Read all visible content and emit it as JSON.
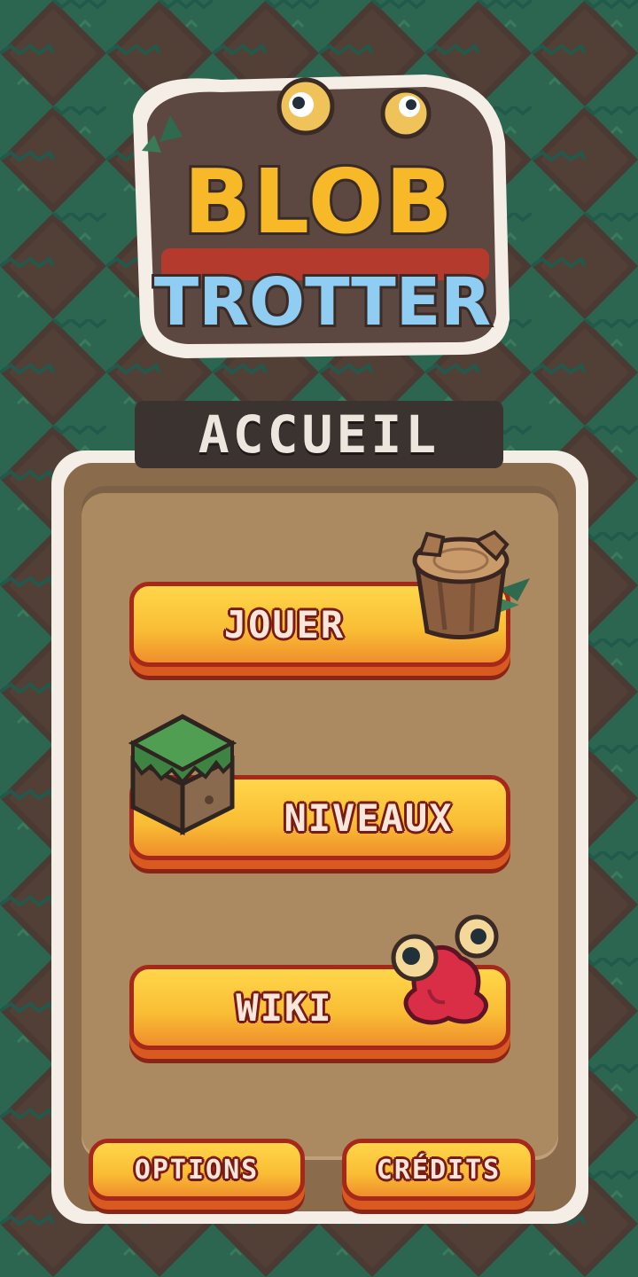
{
  "logo": {
    "line1": "BLOB",
    "line2": "TROTTER"
  },
  "screen": {
    "title": "ACCUEIL"
  },
  "menu": {
    "play": "JOUER",
    "levels": "NIVEAUX",
    "wiki": "WIKI",
    "options": "OPTIONS",
    "credits": "CRÉDITS"
  },
  "colors": {
    "grass": "#2c6650",
    "dirt": "#4a3a33",
    "button_yellow": "#f9bd34",
    "button_orange": "#e55c22",
    "button_outline": "#a5281a",
    "panel_brown": "#ab8a62",
    "logo_yellow": "#f7b928",
    "logo_blue": "#8fcdf2"
  },
  "icons": {
    "play": "tree-stump-icon",
    "levels": "grass-block-icon",
    "wiki": "red-blob-icon"
  }
}
